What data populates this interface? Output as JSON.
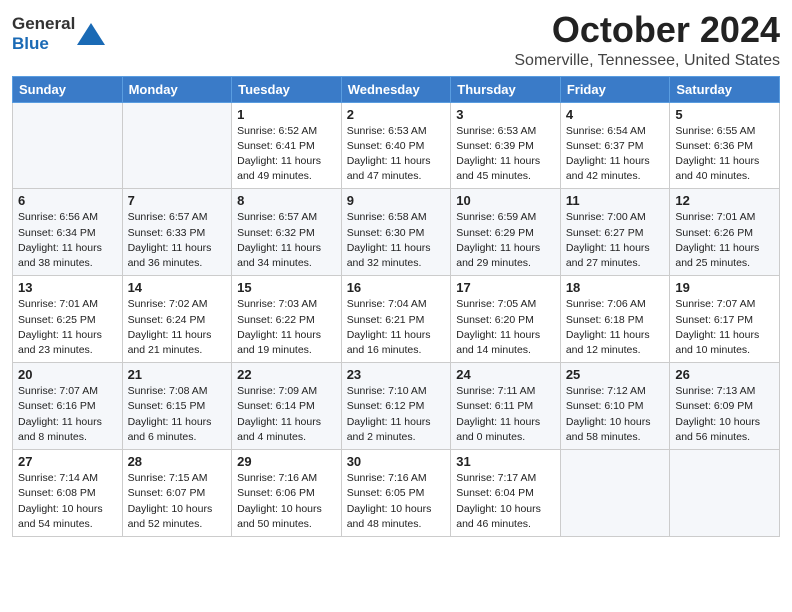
{
  "logo": {
    "line1": "General",
    "line2": "Blue"
  },
  "title": "October 2024",
  "location": "Somerville, Tennessee, United States",
  "weekdays": [
    "Sunday",
    "Monday",
    "Tuesday",
    "Wednesday",
    "Thursday",
    "Friday",
    "Saturday"
  ],
  "weeks": [
    [
      {
        "day": "",
        "info": ""
      },
      {
        "day": "",
        "info": ""
      },
      {
        "day": "1",
        "info": "Sunrise: 6:52 AM\nSunset: 6:41 PM\nDaylight: 11 hours and 49 minutes."
      },
      {
        "day": "2",
        "info": "Sunrise: 6:53 AM\nSunset: 6:40 PM\nDaylight: 11 hours and 47 minutes."
      },
      {
        "day": "3",
        "info": "Sunrise: 6:53 AM\nSunset: 6:39 PM\nDaylight: 11 hours and 45 minutes."
      },
      {
        "day": "4",
        "info": "Sunrise: 6:54 AM\nSunset: 6:37 PM\nDaylight: 11 hours and 42 minutes."
      },
      {
        "day": "5",
        "info": "Sunrise: 6:55 AM\nSunset: 6:36 PM\nDaylight: 11 hours and 40 minutes."
      }
    ],
    [
      {
        "day": "6",
        "info": "Sunrise: 6:56 AM\nSunset: 6:34 PM\nDaylight: 11 hours and 38 minutes."
      },
      {
        "day": "7",
        "info": "Sunrise: 6:57 AM\nSunset: 6:33 PM\nDaylight: 11 hours and 36 minutes."
      },
      {
        "day": "8",
        "info": "Sunrise: 6:57 AM\nSunset: 6:32 PM\nDaylight: 11 hours and 34 minutes."
      },
      {
        "day": "9",
        "info": "Sunrise: 6:58 AM\nSunset: 6:30 PM\nDaylight: 11 hours and 32 minutes."
      },
      {
        "day": "10",
        "info": "Sunrise: 6:59 AM\nSunset: 6:29 PM\nDaylight: 11 hours and 29 minutes."
      },
      {
        "day": "11",
        "info": "Sunrise: 7:00 AM\nSunset: 6:27 PM\nDaylight: 11 hours and 27 minutes."
      },
      {
        "day": "12",
        "info": "Sunrise: 7:01 AM\nSunset: 6:26 PM\nDaylight: 11 hours and 25 minutes."
      }
    ],
    [
      {
        "day": "13",
        "info": "Sunrise: 7:01 AM\nSunset: 6:25 PM\nDaylight: 11 hours and 23 minutes."
      },
      {
        "day": "14",
        "info": "Sunrise: 7:02 AM\nSunset: 6:24 PM\nDaylight: 11 hours and 21 minutes."
      },
      {
        "day": "15",
        "info": "Sunrise: 7:03 AM\nSunset: 6:22 PM\nDaylight: 11 hours and 19 minutes."
      },
      {
        "day": "16",
        "info": "Sunrise: 7:04 AM\nSunset: 6:21 PM\nDaylight: 11 hours and 16 minutes."
      },
      {
        "day": "17",
        "info": "Sunrise: 7:05 AM\nSunset: 6:20 PM\nDaylight: 11 hours and 14 minutes."
      },
      {
        "day": "18",
        "info": "Sunrise: 7:06 AM\nSunset: 6:18 PM\nDaylight: 11 hours and 12 minutes."
      },
      {
        "day": "19",
        "info": "Sunrise: 7:07 AM\nSunset: 6:17 PM\nDaylight: 11 hours and 10 minutes."
      }
    ],
    [
      {
        "day": "20",
        "info": "Sunrise: 7:07 AM\nSunset: 6:16 PM\nDaylight: 11 hours and 8 minutes."
      },
      {
        "day": "21",
        "info": "Sunrise: 7:08 AM\nSunset: 6:15 PM\nDaylight: 11 hours and 6 minutes."
      },
      {
        "day": "22",
        "info": "Sunrise: 7:09 AM\nSunset: 6:14 PM\nDaylight: 11 hours and 4 minutes."
      },
      {
        "day": "23",
        "info": "Sunrise: 7:10 AM\nSunset: 6:12 PM\nDaylight: 11 hours and 2 minutes."
      },
      {
        "day": "24",
        "info": "Sunrise: 7:11 AM\nSunset: 6:11 PM\nDaylight: 11 hours and 0 minutes."
      },
      {
        "day": "25",
        "info": "Sunrise: 7:12 AM\nSunset: 6:10 PM\nDaylight: 10 hours and 58 minutes."
      },
      {
        "day": "26",
        "info": "Sunrise: 7:13 AM\nSunset: 6:09 PM\nDaylight: 10 hours and 56 minutes."
      }
    ],
    [
      {
        "day": "27",
        "info": "Sunrise: 7:14 AM\nSunset: 6:08 PM\nDaylight: 10 hours and 54 minutes."
      },
      {
        "day": "28",
        "info": "Sunrise: 7:15 AM\nSunset: 6:07 PM\nDaylight: 10 hours and 52 minutes."
      },
      {
        "day": "29",
        "info": "Sunrise: 7:16 AM\nSunset: 6:06 PM\nDaylight: 10 hours and 50 minutes."
      },
      {
        "day": "30",
        "info": "Sunrise: 7:16 AM\nSunset: 6:05 PM\nDaylight: 10 hours and 48 minutes."
      },
      {
        "day": "31",
        "info": "Sunrise: 7:17 AM\nSunset: 6:04 PM\nDaylight: 10 hours and 46 minutes."
      },
      {
        "day": "",
        "info": ""
      },
      {
        "day": "",
        "info": ""
      }
    ]
  ]
}
